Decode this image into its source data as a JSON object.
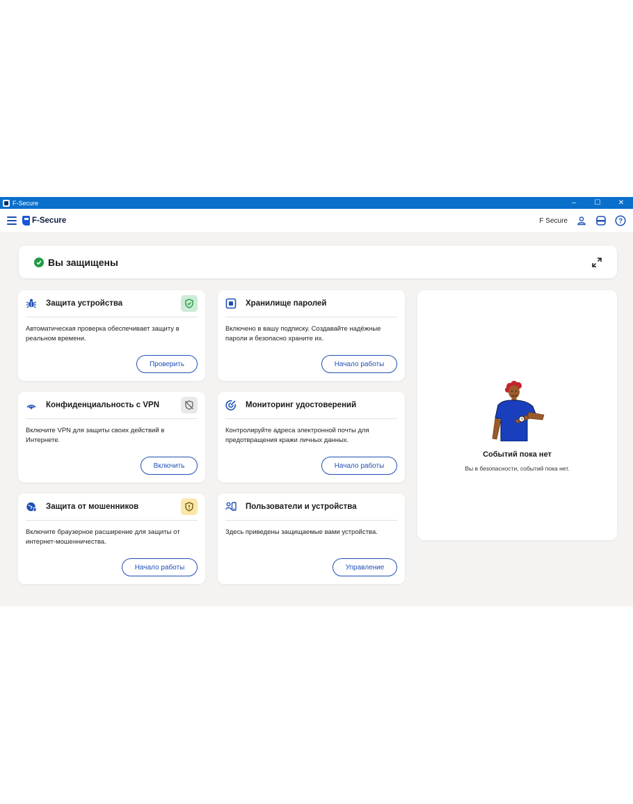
{
  "window": {
    "title": "F-Secure",
    "controls": {
      "minimize": "–",
      "maximize": "☐",
      "close": "✕"
    }
  },
  "header": {
    "logo_text": "F-Secure",
    "user_label": "F Secure",
    "icons": [
      "menu-icon",
      "account-icon",
      "subscription-icon",
      "help-icon"
    ]
  },
  "status": {
    "text": "Вы защищены",
    "color": "#1e9c45"
  },
  "cards": [
    {
      "title": "Защита устройства",
      "description": "Автоматическая проверка обеспечивает защиту в реальном времени.",
      "button": "Проверить",
      "icon": "bug-icon",
      "badge": "shield-check-icon",
      "badge_color": "#cdebd6"
    },
    {
      "title": "Хранилище паролей",
      "description": "Включено в вашу подписку. Создавайте надёжные пароли и безопасно храните их.",
      "button": "Начало работы",
      "icon": "vault-icon"
    },
    {
      "title": "Конфиденциальность с VPN",
      "description": "Включите VPN для защиты своих действий в Интернете.",
      "button": "Включить",
      "icon": "vpn-signal-icon",
      "badge": "shield-off-icon",
      "badge_color": "#ebe9e7"
    },
    {
      "title": "Мониторинг удостоверений",
      "description": "Контролируйте адреса электронной почты для предотвращения кражи личных данных.",
      "button": "Начало работы",
      "icon": "radar-icon"
    },
    {
      "title": "Защита от мошенников",
      "description": "Включите браузерное расширение для защиты от интернет-мошенничества.",
      "button": "Начало работы",
      "icon": "globe-shield-icon",
      "badge": "shield-alert-icon",
      "badge_color": "#fbe7a8"
    },
    {
      "title": "Пользователи и устройства",
      "description": "Здесь приведены защищаемые вами устройства.",
      "button": "Управление",
      "icon": "users-devices-icon"
    }
  ],
  "events": {
    "title": "Событий пока нет",
    "subtitle": "Вы в безопасности, событий пока нет."
  },
  "colors": {
    "accent": "#1f4fb5",
    "titlebar": "#0a6fcb",
    "background": "#f5f3f1"
  }
}
